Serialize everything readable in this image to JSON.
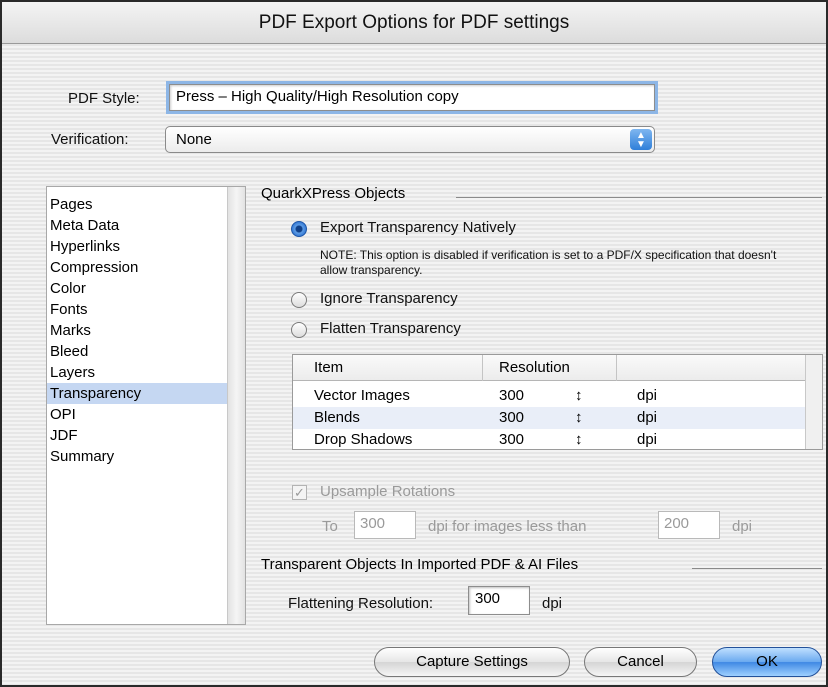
{
  "window": {
    "title": "PDF Export Options for PDF settings"
  },
  "form": {
    "pdf_style_label": "PDF Style:",
    "pdf_style_value": "Press – High Quality/High Resolution copy",
    "verification_label": "Verification:",
    "verification_value": "None"
  },
  "sidebar": {
    "items": [
      {
        "label": "Pages"
      },
      {
        "label": "Meta Data"
      },
      {
        "label": "Hyperlinks"
      },
      {
        "label": "Compression"
      },
      {
        "label": "Color"
      },
      {
        "label": "Fonts"
      },
      {
        "label": "Marks"
      },
      {
        "label": "Bleed"
      },
      {
        "label": "Layers"
      },
      {
        "label": "Transparency",
        "selected": true
      },
      {
        "label": "OPI"
      },
      {
        "label": "JDF"
      },
      {
        "label": "Summary"
      }
    ]
  },
  "quark": {
    "title": "QuarkXPress Objects",
    "export_native_label": "Export Transparency Natively",
    "note": "NOTE: This option is disabled if verification is set to a PDF/X specification that doesn't allow transparency.",
    "ignore_label": "Ignore Transparency",
    "flatten_label": "Flatten Transparency",
    "selected_option": "Export Transparency Natively"
  },
  "table": {
    "headers": [
      "Item",
      "Resolution"
    ],
    "rows": [
      {
        "item": "Vector Images",
        "resolution": "300",
        "unit": "dpi"
      },
      {
        "item": "Blends",
        "resolution": "300",
        "unit": "dpi"
      },
      {
        "item": "Drop Shadows",
        "resolution": "300",
        "unit": "dpi"
      }
    ]
  },
  "upsample": {
    "label": "Upsample Rotations",
    "checked": true,
    "to_label": "To",
    "to_value": "300",
    "middle_label": "dpi for images less than",
    "less_value": "200",
    "unit": "dpi"
  },
  "imported": {
    "title": "Transparent Objects In Imported PDF & AI Files",
    "flattening_label": "Flattening Resolution:",
    "flattening_value": "300",
    "unit": "dpi"
  },
  "buttons": {
    "capture": "Capture Settings",
    "cancel": "Cancel",
    "ok": "OK"
  },
  "icons": {
    "popup_arrows": "▲▼",
    "stepper": "↕",
    "checkmark": "✓"
  },
  "colors": {
    "selection": "#c5d7f2",
    "default_button": "#3f88e4"
  }
}
